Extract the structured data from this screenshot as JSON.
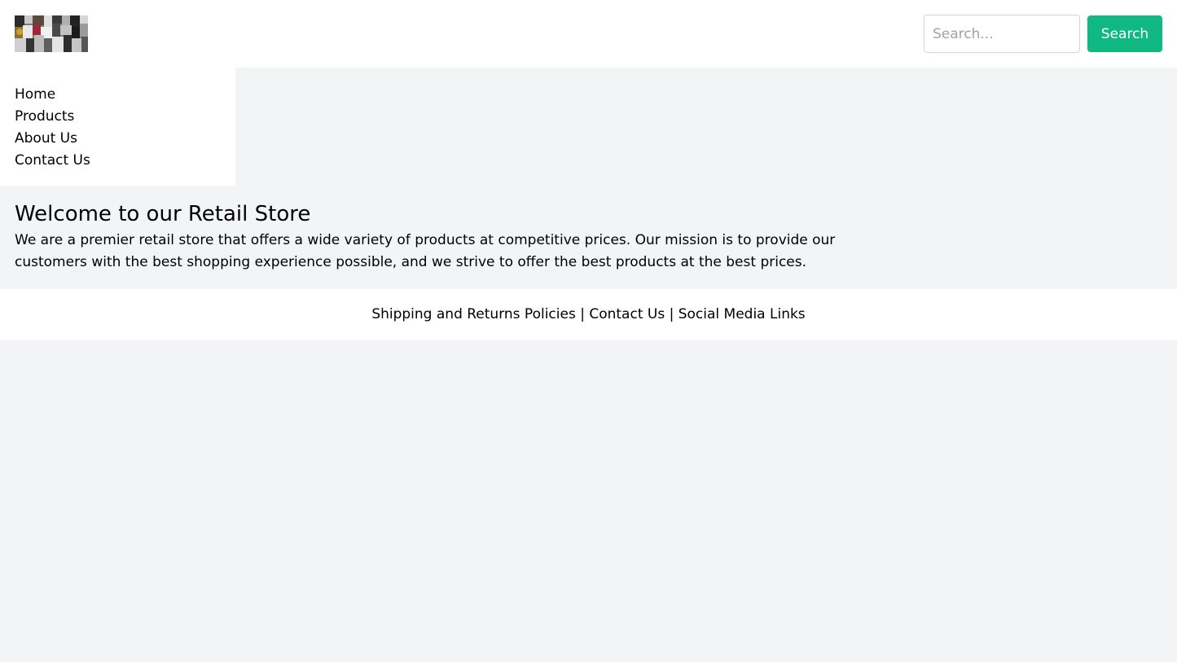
{
  "header": {
    "logo_icon": "store-logo-collage",
    "search": {
      "placeholder": "Search...",
      "value": ""
    },
    "search_button_label": "Search",
    "colors": {
      "accent": "#10b981",
      "background": "#ffffff"
    }
  },
  "sidebar": {
    "items": [
      {
        "label": "Home"
      },
      {
        "label": "Products"
      },
      {
        "label": "About Us"
      },
      {
        "label": "Contact Us"
      }
    ]
  },
  "main": {
    "title": "Welcome to our Retail Store",
    "description": "We are a premier retail store that offers a wide variety of products at competitive prices. Our mission is to provide our customers with the best shopping experience possible, and we strive to offer the best products at the best prices."
  },
  "footer": {
    "text": "Shipping and Returns Policies | Contact Us | Social Media Links"
  },
  "page": {
    "background": "#f3f4f6"
  }
}
